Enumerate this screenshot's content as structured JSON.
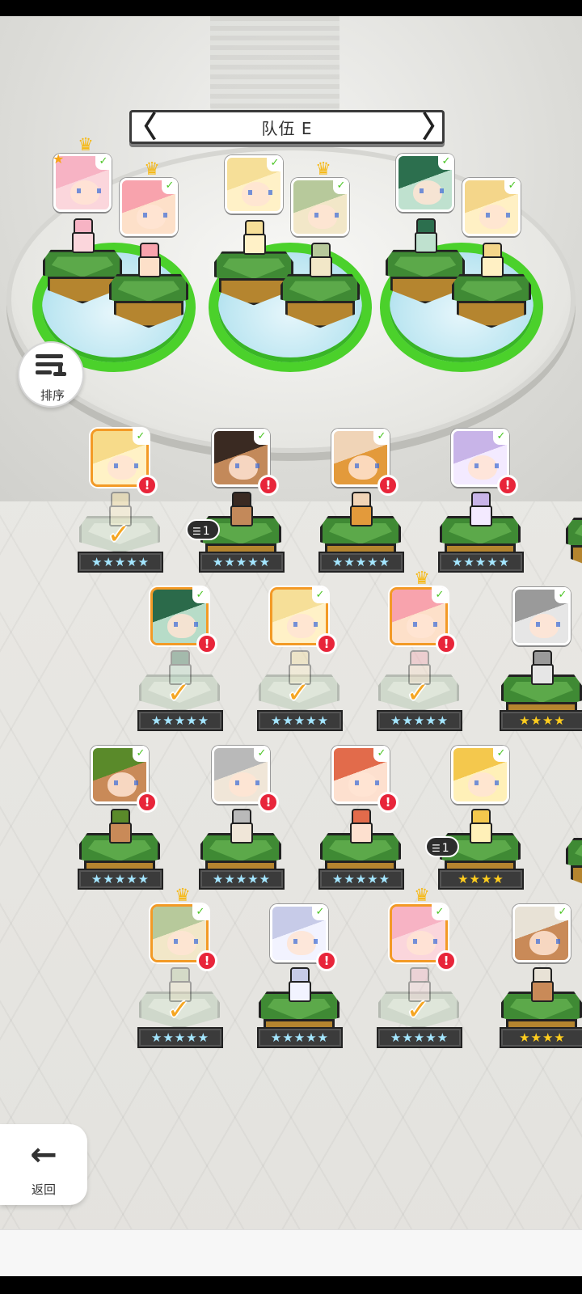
{
  "header": {
    "team_title": "队伍 E",
    "prev_glyph": "〈",
    "next_glyph": "〉"
  },
  "sort_button": {
    "label": "排序",
    "icon": "sort-lines-icon"
  },
  "back_button": {
    "label": "返回",
    "icon": "arrow-left-icon",
    "glyph": "←"
  },
  "badges": {
    "alert_glyph": "!",
    "leaf_glyph": "✓",
    "check_glyph": "✓",
    "crown_glyph": "♛",
    "star_glyph": "★"
  },
  "colors": {
    "selected_border": "#f39a26",
    "alert_red": "#e8253a",
    "grass_green": "#4bd12b",
    "crown_gold": "#f6b814",
    "stars_blue": "#a4e6ff",
    "stars_gold": "#ffcd1e"
  },
  "team_slots": [
    {
      "crown": true,
      "marked_star": true,
      "palette": [
        "#f7b3c4",
        "#fbd6dc"
      ]
    },
    {
      "crown": true,
      "marked_star": false,
      "palette": [
        "#f8a3ad",
        "#fde0c9"
      ]
    },
    {
      "crown": false,
      "marked_star": false,
      "palette": [
        "#f6df98",
        "#fff1c7"
      ]
    },
    {
      "crown": true,
      "marked_star": false,
      "palette": [
        "#b7c99b",
        "#f2e7c8"
      ]
    },
    {
      "crown": false,
      "marked_star": false,
      "palette": [
        "#2c6f4e",
        "#bfe1cf"
      ]
    },
    {
      "crown": false,
      "marked_star": false,
      "palette": [
        "#f4d68a",
        "#fff0c4"
      ]
    }
  ],
  "roster_rows": [
    [
      {
        "selected": true,
        "alert": true,
        "check": true,
        "stars": "★★★★★",
        "star_color": "blue",
        "palette": [
          "#f7db8a",
          "#fff2c6"
        ]
      },
      {
        "selected": false,
        "alert": true,
        "check": false,
        "stars": "★★★★★",
        "star_color": "blue",
        "stack": "1",
        "palette": [
          "#3a2a22",
          "#c3895a"
        ]
      },
      {
        "selected": false,
        "alert": true,
        "check": false,
        "stars": "★★★★★",
        "star_color": "blue",
        "palette": [
          "#f0d4b7",
          "#e39a3b"
        ]
      },
      {
        "selected": false,
        "alert": true,
        "check": false,
        "stars": "★★★★★",
        "star_color": "blue",
        "palette": [
          "#c8b4e8",
          "#f3eaff"
        ]
      }
    ],
    [
      {
        "selected": true,
        "alert": true,
        "check": true,
        "stars": "★★★★★",
        "star_color": "blue",
        "palette": [
          "#2b6a4a",
          "#b7dcc8"
        ]
      },
      {
        "selected": true,
        "alert": true,
        "check": true,
        "stars": "★★★★★",
        "star_color": "blue",
        "palette": [
          "#f6df98",
          "#fff1c7"
        ]
      },
      {
        "selected": true,
        "alert": true,
        "check": true,
        "stars": "★★★★★",
        "star_color": "blue",
        "crown": true,
        "palette": [
          "#f8a3ad",
          "#fde0c9"
        ]
      },
      {
        "selected": false,
        "alert": false,
        "check": false,
        "stars": "★★★★",
        "star_color": "gold",
        "palette": [
          "#9a9a9a",
          "#e6e6e6"
        ]
      }
    ],
    [
      {
        "selected": false,
        "alert": true,
        "check": false,
        "stars": "★★★★★",
        "star_color": "blue",
        "palette": [
          "#5a8a2a",
          "#c98a58"
        ]
      },
      {
        "selected": false,
        "alert": true,
        "check": false,
        "stars": "★★★★★",
        "star_color": "blue",
        "palette": [
          "#b9b9b9",
          "#f0e6d8"
        ]
      },
      {
        "selected": false,
        "alert": true,
        "check": false,
        "stars": "★★★★★",
        "star_color": "blue",
        "palette": [
          "#e26b4b",
          "#fde0cf"
        ]
      },
      {
        "selected": false,
        "alert": false,
        "check": false,
        "stars": "★★★★",
        "star_color": "gold",
        "stack": "1",
        "palette": [
          "#f4c84d",
          "#fff0b8"
        ]
      }
    ],
    [
      {
        "selected": true,
        "alert": true,
        "check": true,
        "stars": "★★★★★",
        "star_color": "blue",
        "crown": true,
        "palette": [
          "#b7c99b",
          "#f2e7c8"
        ]
      },
      {
        "selected": false,
        "alert": true,
        "check": false,
        "stars": "★★★★★",
        "star_color": "blue",
        "palette": [
          "#c7cbe8",
          "#f2f3ff"
        ]
      },
      {
        "selected": true,
        "alert": true,
        "check": true,
        "stars": "★★★★★",
        "star_color": "blue",
        "crown": true,
        "palette": [
          "#f7b3c4",
          "#fbd6dc"
        ]
      },
      {
        "selected": false,
        "alert": false,
        "check": false,
        "stars": "★★★★",
        "star_color": "gold",
        "palette": [
          "#e8e2d6",
          "#c98a58"
        ]
      }
    ]
  ],
  "edge_stacks": [
    {
      "row": 0,
      "value": ""
    },
    {
      "row": 2,
      "value": ""
    }
  ]
}
